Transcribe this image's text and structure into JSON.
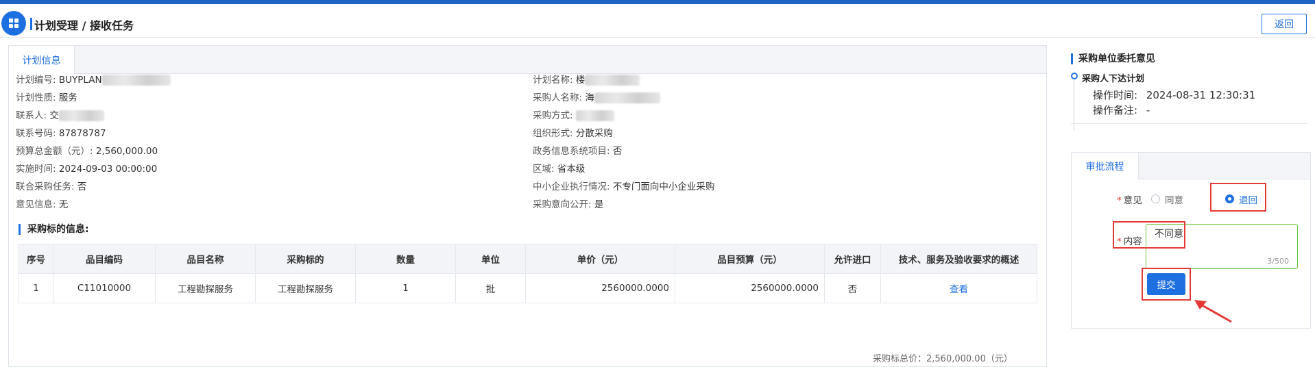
{
  "header": {
    "breadcrumb": "计划受理 / 接收任务",
    "back_label": "返回"
  },
  "plan_tab": "计划信息",
  "fields_left": [
    {
      "label": "计划编号:",
      "value": "BUYPLAN"
    },
    {
      "label": "计划性质:",
      "value": "服务"
    },
    {
      "label": "联系人:",
      "value": "交"
    },
    {
      "label": "联系号码:",
      "value": "87878787"
    },
    {
      "label": "预算总金额（元）:",
      "value": "2,560,000.00"
    },
    {
      "label": "实施时间:",
      "value": "2024-09-03 00:00:00"
    },
    {
      "label": "联合采购任务:",
      "value": "否"
    },
    {
      "label": "意见信息:",
      "value": "无"
    }
  ],
  "fields_right": [
    {
      "label": "计划名称:",
      "value": "楼"
    },
    {
      "label": "采购人名称:",
      "value": "海"
    },
    {
      "label": "采购方式:",
      "value": ""
    },
    {
      "label": "组织形式:",
      "value": "分散采购"
    },
    {
      "label": "政务信息系统项目:",
      "value": "否"
    },
    {
      "label": "区域:",
      "value": "省本级"
    },
    {
      "label": "中小企业执行情况:",
      "value": "不专门面向中小企业采购"
    },
    {
      "label": "采购意向公开:",
      "value": "是"
    }
  ],
  "table_section_title": "采购标的信息:",
  "table": {
    "columns": [
      "序号",
      "品目编码",
      "品目名称",
      "采购标的",
      "数量",
      "单位",
      "单价（元）",
      "品目预算（元）",
      "允许进口",
      "技术、服务及验收要求的概述"
    ],
    "rows": [
      [
        "1",
        "C11010000",
        "工程勘探服务",
        "工程勘探服务",
        "1",
        "批",
        "2560000.0000",
        "2560000.0000",
        "否",
        "查看"
      ]
    ]
  },
  "total_text": "采购标总价：2,560,000.00（元）",
  "opinion": {
    "title": "采购单位委托意见",
    "event": "采购人下达计划",
    "time_label": "操作时间:",
    "time_value": "2024-08-31 12:30:31",
    "note_label": "操作备注:",
    "note_value": "-"
  },
  "approval": {
    "tab": "审批流程",
    "opinion_label": "意见",
    "option_agree": "同意",
    "option_return": "退回",
    "selected": "退回",
    "content_label": "内容",
    "content_value": "不同意",
    "counter": "3/500",
    "submit_label": "提交"
  },
  "colors": {
    "accent": "#1e6fe0",
    "annotation_red": "#e53935"
  }
}
